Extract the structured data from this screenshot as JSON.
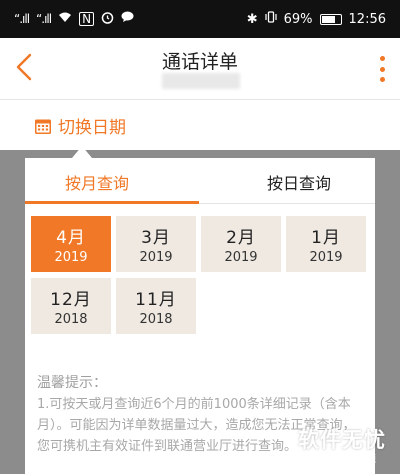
{
  "status_bar": {
    "signal_1": "“.ıll",
    "signal_2": "“.ıll",
    "battery_percent": "69%",
    "time": "12:56"
  },
  "header": {
    "title": "通话详单"
  },
  "switch_date": {
    "label": "切换日期"
  },
  "tabs": [
    {
      "label": "按月查询",
      "selected": true
    },
    {
      "label": "按日查询",
      "selected": false
    }
  ],
  "months": [
    {
      "month": "4月",
      "year": "2019",
      "selected": true
    },
    {
      "month": "3月",
      "year": "2019",
      "selected": false
    },
    {
      "month": "2月",
      "year": "2019",
      "selected": false
    },
    {
      "month": "1月",
      "year": "2019",
      "selected": false
    },
    {
      "month": "12月",
      "year": "2018",
      "selected": false
    },
    {
      "month": "11月",
      "year": "2018",
      "selected": false
    }
  ],
  "tips": {
    "title": "温馨提示：",
    "text": "1.可按天或月查询近6个月的前1000条详细记录（含本月）。可能因为详单数据量过大，造成您无法正常查询，您可携机主有效证件到联通营业厅进行查询。"
  },
  "watermark": {
    "title": "软件无忧",
    "subtitle": "努力解决软件问题"
  },
  "colors": {
    "accent": "#f07826",
    "cell_bg": "#efe9e2",
    "overlay": "#8c8c8c"
  }
}
